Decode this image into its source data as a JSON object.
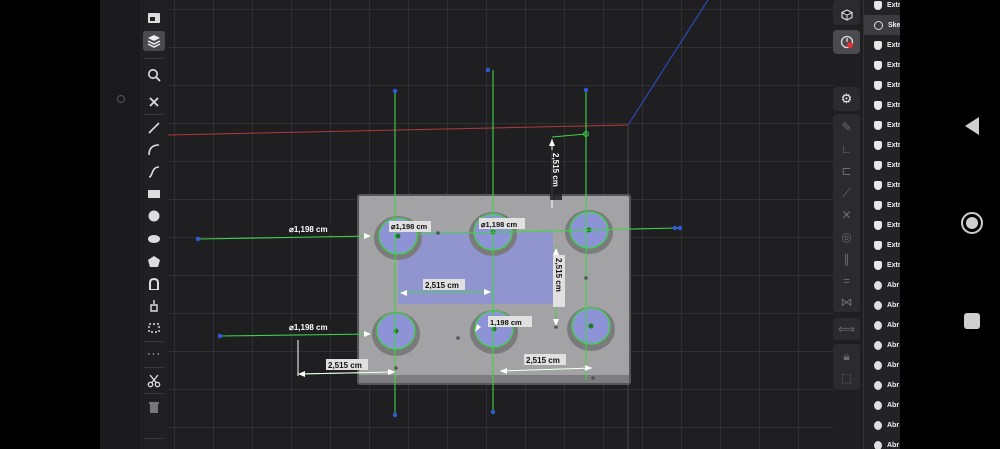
{
  "app": {
    "accent_green": "#3fd24a",
    "accent_blue": "#2f5bd6",
    "plate_color": "#9c9c9e",
    "sketch_fill": "#8d93d6"
  },
  "left_toolbar": {
    "tools": [
      {
        "name": "display-mode-icon"
      },
      {
        "name": "layers-icon"
      },
      {
        "name": "search-icon"
      },
      {
        "name": "close-icon"
      },
      {
        "name": "line-tool-icon"
      },
      {
        "name": "arc-tool-icon"
      },
      {
        "name": "spline-tool-icon"
      },
      {
        "name": "rectangle-tool-icon"
      },
      {
        "name": "circle-tool-icon"
      },
      {
        "name": "ellipse-tool-icon"
      },
      {
        "name": "polygon-tool-icon"
      },
      {
        "name": "slot-tool-icon"
      },
      {
        "name": "point-tool-icon"
      },
      {
        "name": "offset-tool-icon"
      },
      {
        "name": "more-icon"
      },
      {
        "name": "scissors-icon"
      },
      {
        "name": "trash-icon"
      }
    ]
  },
  "dimensions": {
    "d1": "⌀1,198 cm",
    "d2": "⌀1,198 cm",
    "d3": "⌀1,198 cm",
    "d4": "⌀1,198 cm",
    "d5": "1,198 cm",
    "v1": "2,515 cm",
    "v2": "2,515 cm",
    "h1": "2,515 cm",
    "h2": "2,515 cm",
    "h3": "2,515 cm"
  },
  "tree": {
    "items": [
      {
        "label": "Extr",
        "type": "extrude"
      },
      {
        "label": "Ske",
        "type": "sketch"
      },
      {
        "label": "Extr",
        "type": "extrude"
      },
      {
        "label": "Extr",
        "type": "extrude"
      },
      {
        "label": "Extr",
        "type": "extrude"
      },
      {
        "label": "Extr",
        "type": "extrude"
      },
      {
        "label": "Extr",
        "type": "extrude"
      },
      {
        "label": "Extr",
        "type": "extrude"
      },
      {
        "label": "Extr",
        "type": "extrude"
      },
      {
        "label": "Extr",
        "type": "extrude"
      },
      {
        "label": "Extr",
        "type": "extrude"
      },
      {
        "label": "Extr",
        "type": "extrude"
      },
      {
        "label": "Extr",
        "type": "extrude"
      },
      {
        "label": "Extr",
        "type": "extrude"
      },
      {
        "label": "Abr",
        "type": "fillet"
      },
      {
        "label": "Abr",
        "type": "fillet"
      },
      {
        "label": "Abr",
        "type": "fillet"
      },
      {
        "label": "Abr",
        "type": "fillet"
      },
      {
        "label": "Abr",
        "type": "fillet"
      },
      {
        "label": "Abr",
        "type": "fillet"
      },
      {
        "label": "Abr",
        "type": "fillet"
      },
      {
        "label": "Abr",
        "type": "fillet"
      },
      {
        "label": "Abr",
        "type": "fillet"
      }
    ]
  }
}
